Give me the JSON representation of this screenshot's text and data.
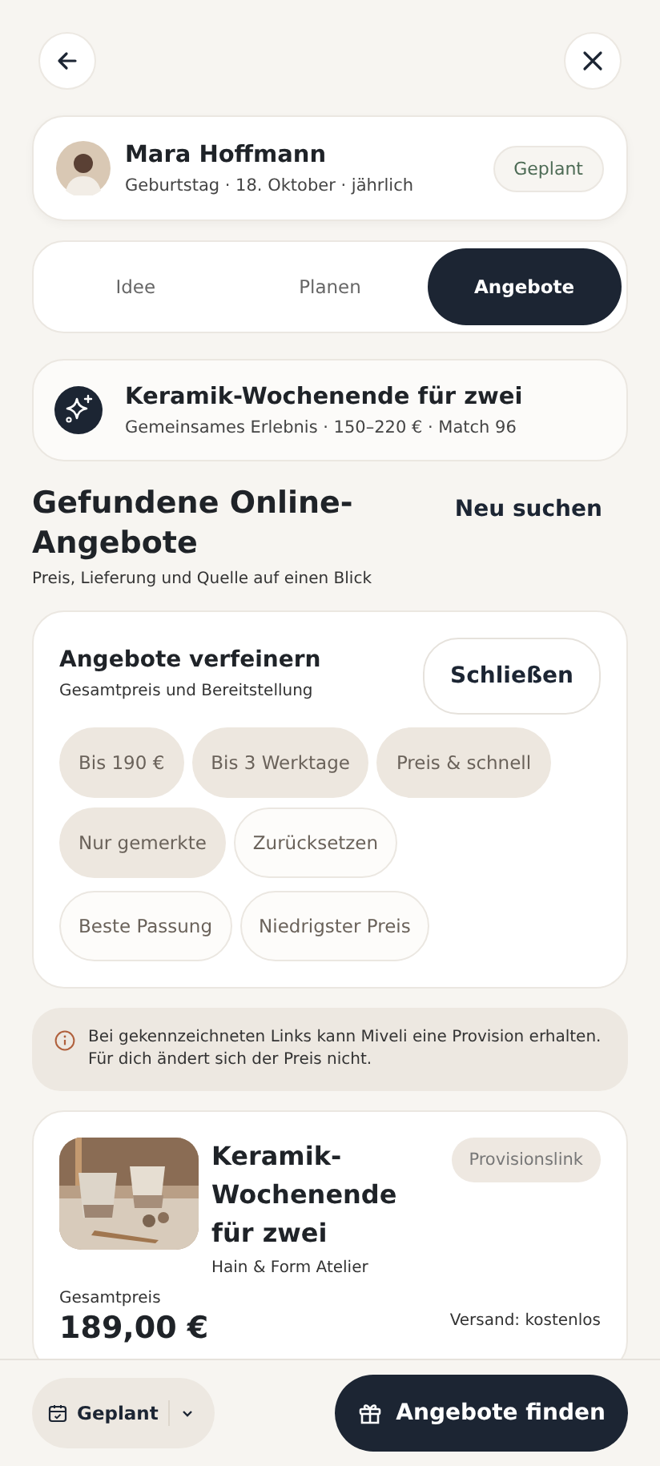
{
  "person": {
    "name": "Mara Hoffmann",
    "details": "Geburtstag · 18. Oktober · jährlich",
    "status": "Geplant"
  },
  "tabs": [
    {
      "label": "Idee",
      "selected": false
    },
    {
      "label": "Planen",
      "selected": false
    },
    {
      "label": "Angebote",
      "selected": true
    }
  ],
  "idea": {
    "title": "Keramik-Wochenende für zwei",
    "details": "Gemeinsames Erlebnis · 150–220 € · Match 96"
  },
  "section": {
    "title": "Gefundene Online-Angebote",
    "subtitle": "Preis, Lieferung und Quelle auf einen Blick",
    "action": "Neu suchen"
  },
  "filters": {
    "title": "Angebote verfeinern",
    "subtitle": "Gesamtpreis und Bereitstellung",
    "close": "Schließen",
    "rows": [
      [
        {
          "label": "Bis 190 €",
          "selected": true
        },
        {
          "label": "Bis 3 Werktage",
          "selected": true
        },
        {
          "label": "Preis & schnell",
          "selected": true
        }
      ],
      [
        {
          "label": "Nur gemerkte",
          "selected": true
        },
        {
          "label": "Zurücksetzen",
          "selected": false
        }
      ],
      [
        {
          "label": "Beste Passung",
          "selected": false
        },
        {
          "label": "Niedrigster Preis",
          "selected": false
        }
      ]
    ]
  },
  "notice": "Bei gekennzeichneten Links kann Miveli eine Provision erhalten. Für dich ändert sich der Preis nicht.",
  "offer": {
    "title": "Keramik-Wochenende für zwei",
    "vendor": "Hain & Form Atelier",
    "tag": "Provisionslink",
    "price_label": "Gesamtpreis",
    "price": "189,00 €",
    "shipping": "Versand: kostenlos"
  },
  "bottom_bar": {
    "status": "Geplant",
    "action": "Angebote finden"
  }
}
